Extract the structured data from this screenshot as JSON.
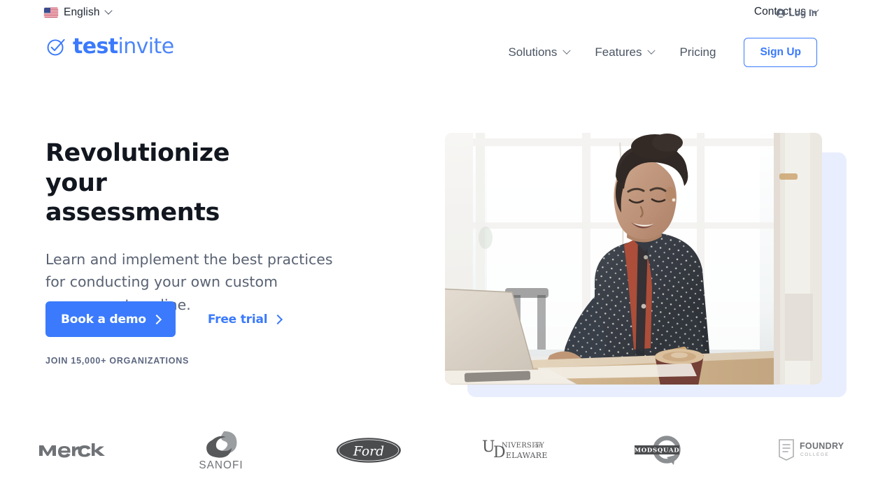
{
  "utility": {
    "language": {
      "label": "English",
      "flag_icon": "us-flag-icon",
      "chevron_icon": "chevron-down-icon"
    },
    "contact": {
      "label": "Contact us",
      "chevron_icon": "chevron-down-icon"
    },
    "login": {
      "label": "Log In",
      "icon": "user-circle-icon"
    }
  },
  "brand": {
    "mark_icon": "check-circle-icon",
    "name_bold": "test",
    "name_light": "invite",
    "color": "#3b7afc"
  },
  "nav": {
    "items": [
      {
        "label": "Solutions",
        "has_chevron": true,
        "chevron_icon": "chevron-down-icon"
      },
      {
        "label": "Features",
        "has_chevron": true,
        "chevron_icon": "chevron-down-icon"
      },
      {
        "label": "Pricing",
        "has_chevron": false,
        "chevron_icon": ""
      }
    ],
    "signup_label": "Sign Up"
  },
  "hero": {
    "title": "Revolutionize your assessments",
    "subtitle": "Learn and implement the best practices for conducting your own custom assessments online.",
    "primary_cta": {
      "label": "Book a demo",
      "icon": "chevron-right-icon",
      "bg": "#3b7afc",
      "text_color": "#ffffff"
    },
    "secondary_cta": {
      "label": "Free trial",
      "icon": "chevron-right-icon",
      "text_color": "#3b7afc"
    },
    "social_proof": "JOIN 15,000+ ORGANIZATIONS",
    "image_alt": "Smiling woman in polka-dot shirt working on a laptop at a cafe table with a coffee cup",
    "decorative_panel_color": "#e9eeff"
  },
  "clients": {
    "logos": [
      {
        "name": "Merck",
        "icon": "merck-logo"
      },
      {
        "name": "SANOFI",
        "icon": "sanofi-logo"
      },
      {
        "name": "Ford",
        "icon": "ford-logo"
      },
      {
        "name": "University of Delaware",
        "icon": "university-of-delaware-logo"
      },
      {
        "name": "MODSQUAD",
        "icon": "modsquad-logo"
      },
      {
        "name": "FOUNDRY COLLEGE",
        "icon": "foundry-college-logo"
      }
    ]
  }
}
